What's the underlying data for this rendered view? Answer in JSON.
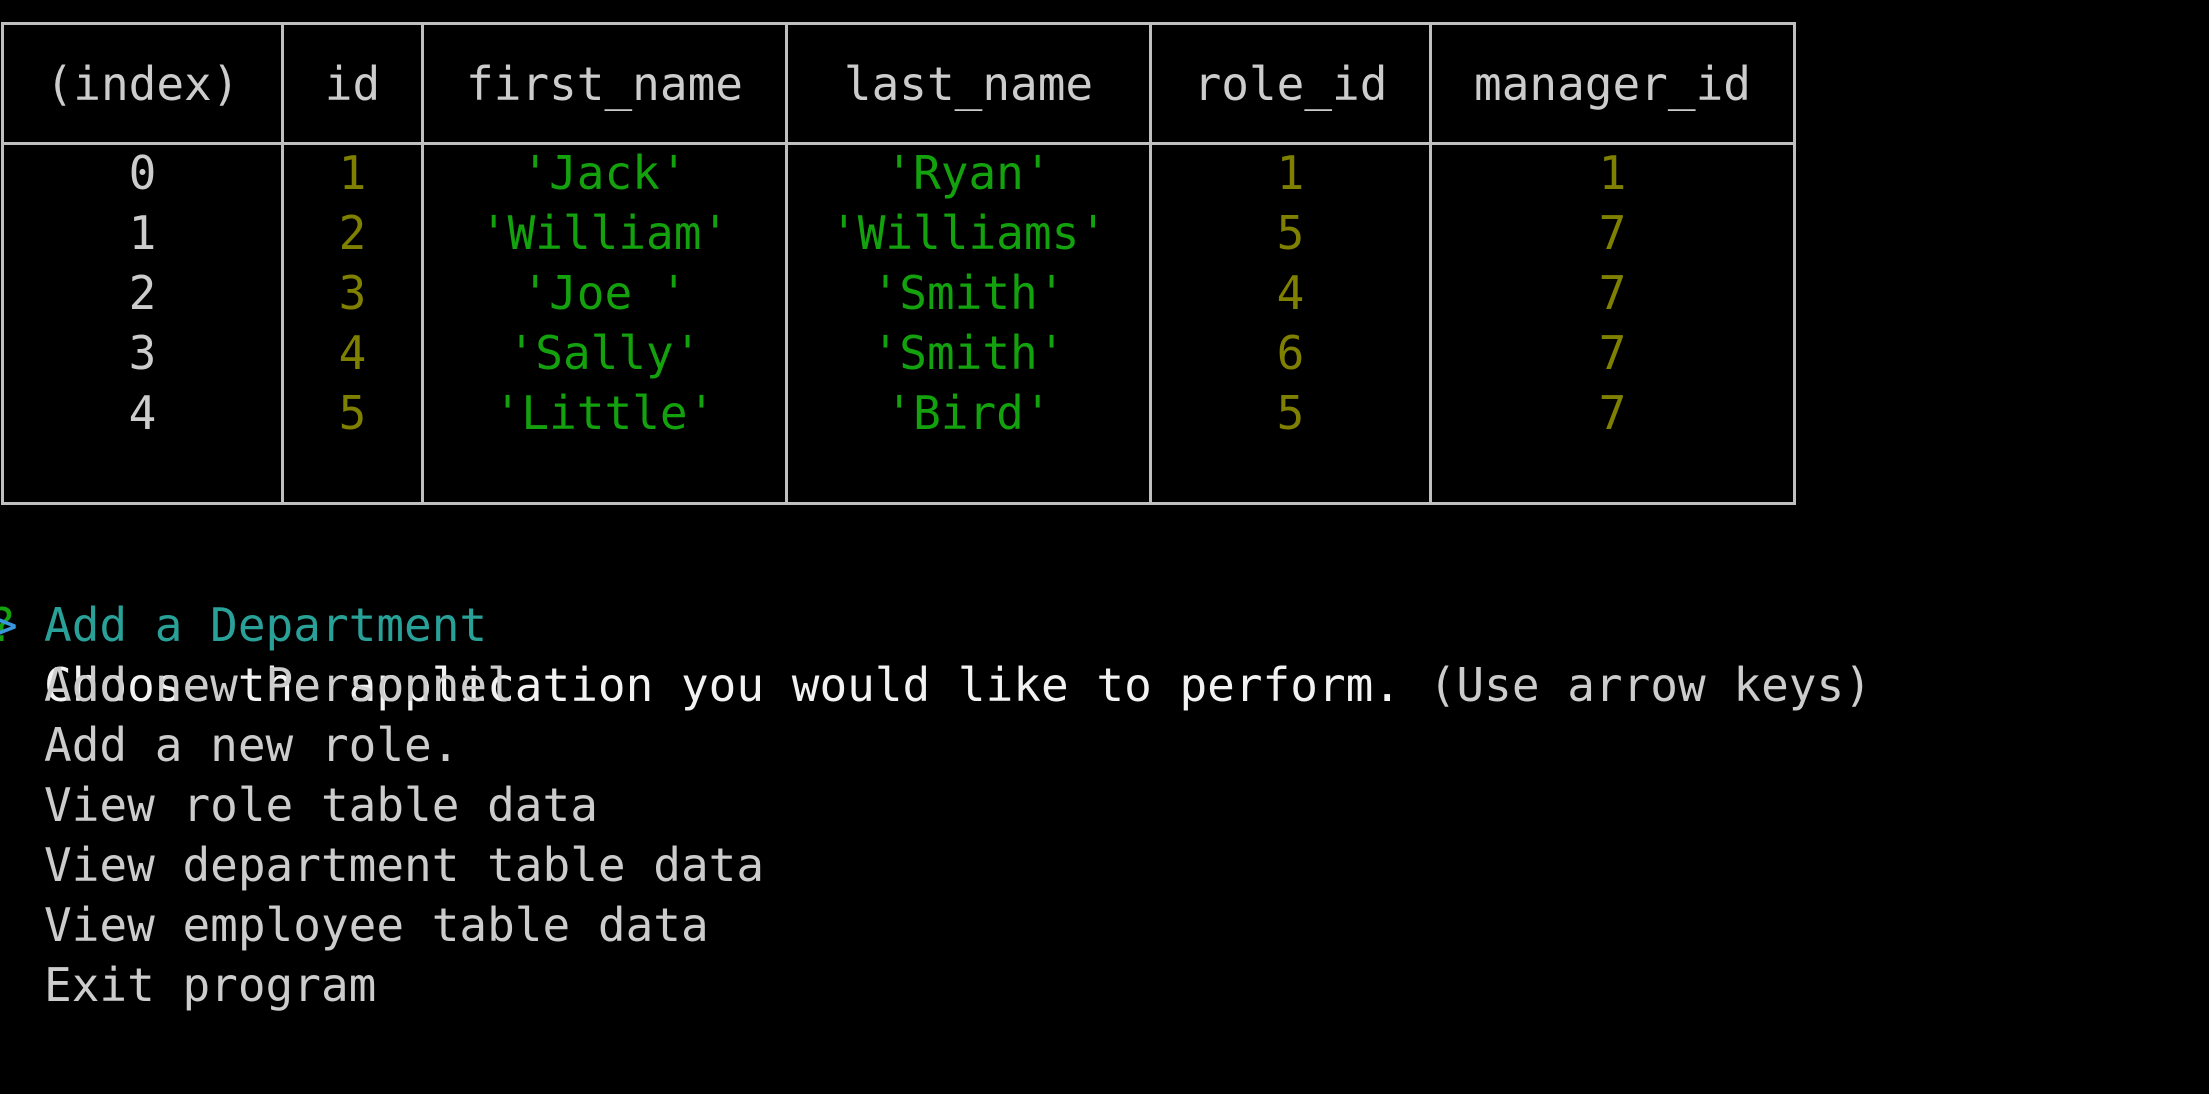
{
  "table": {
    "columns": [
      "(index)",
      "id",
      "first_name",
      "last_name",
      "role_id",
      "manager_id"
    ],
    "rows": [
      [
        "0",
        "1",
        "'Jack'",
        "'Ryan'",
        "1",
        "1"
      ],
      [
        "1",
        "2",
        "'William'",
        "'Williams'",
        "5",
        "7"
      ],
      [
        "2",
        "3",
        "'Joe '",
        "'Smith'",
        "4",
        "7"
      ],
      [
        "3",
        "4",
        "'Sally'",
        "'Smith'",
        "6",
        "7"
      ],
      [
        "4",
        "5",
        "'Little'",
        "'Bird'",
        "5",
        "7"
      ]
    ]
  },
  "prompt": {
    "qmark": "?",
    "question": "Choose the application you would like to perform.",
    "hint": "(Use arrow keys)",
    "pointer": ">",
    "choices": [
      "Add a Department",
      "Add new Personnel",
      "Add a new role.",
      "View role table data",
      "View department table data",
      "View employee table data",
      "Exit program"
    ],
    "selected_index": 0
  },
  "colors": {
    "background": "#000000",
    "border": "#bfbfbf",
    "number": "#808000",
    "string": "#13a10e",
    "selected": "#2aa198",
    "text": "#cccccc"
  }
}
